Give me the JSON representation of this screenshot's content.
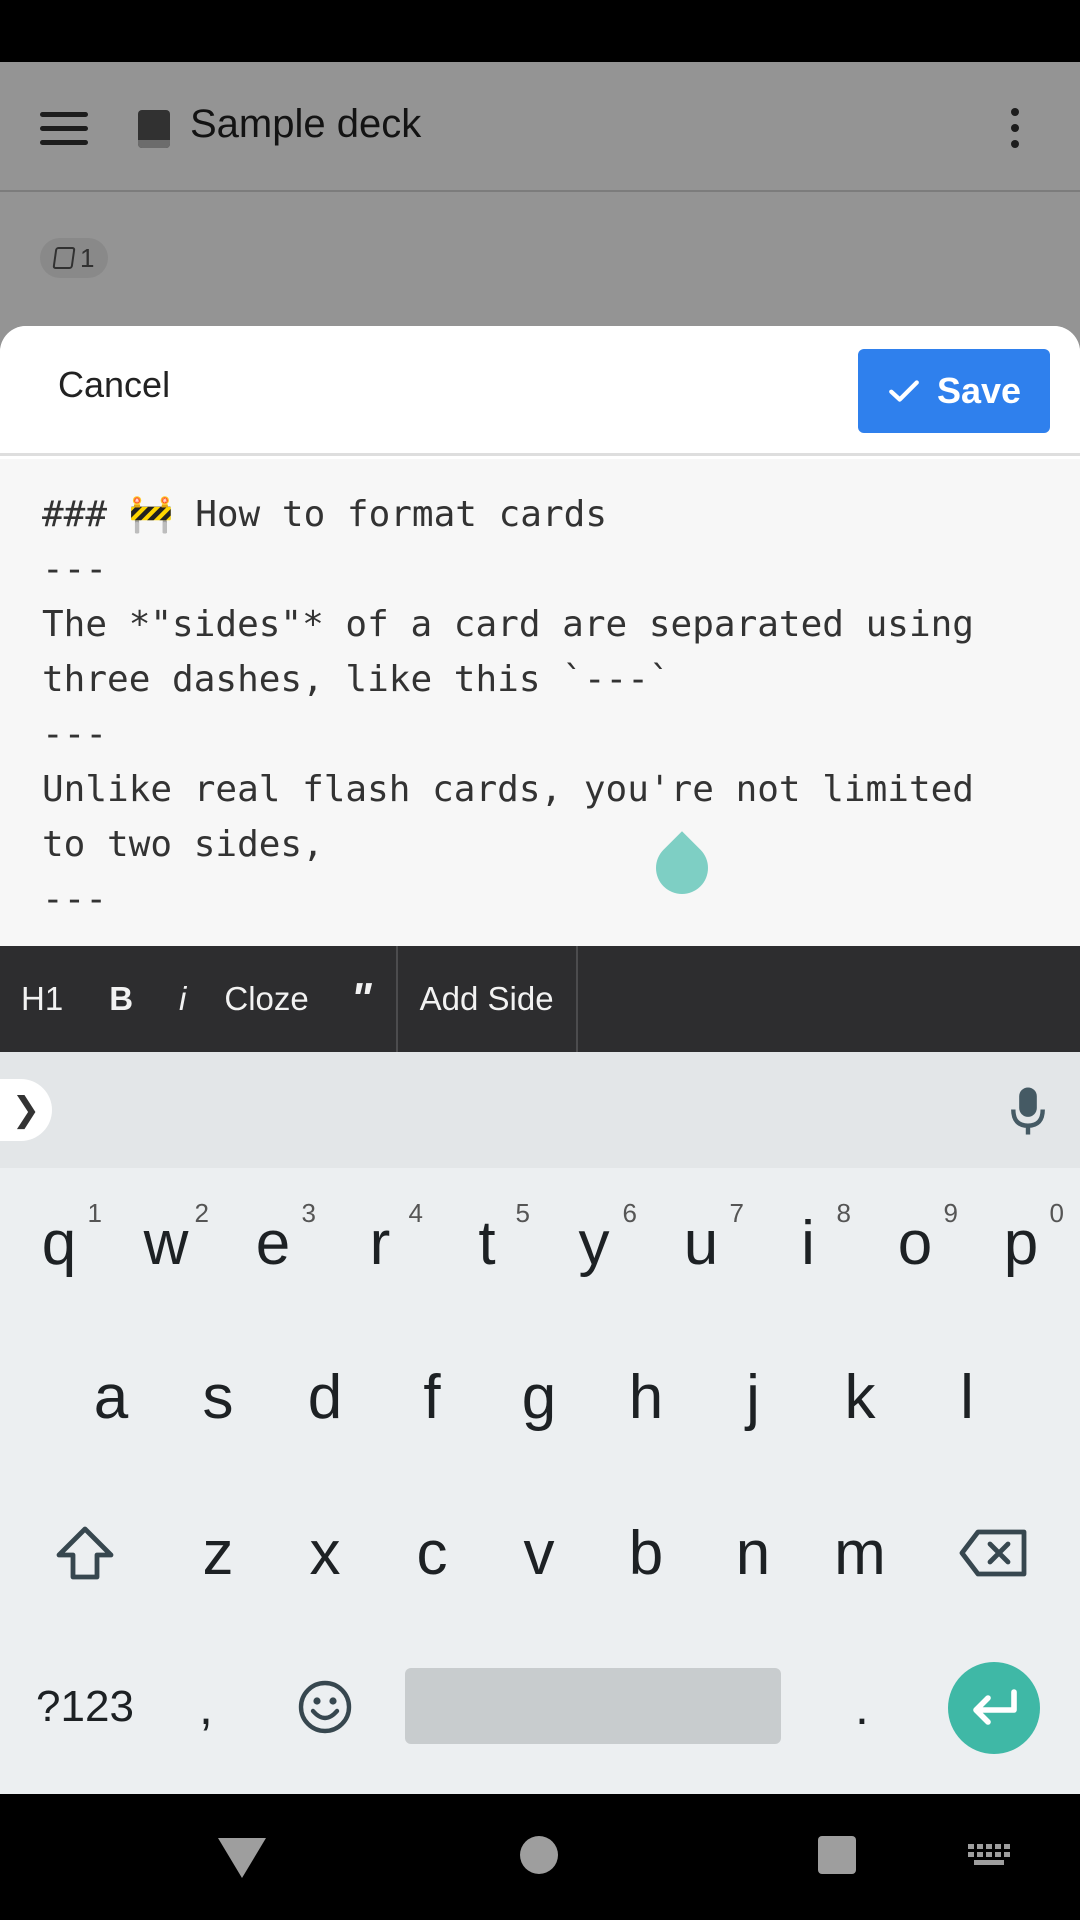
{
  "app": {
    "deck_title": "Sample deck",
    "card_count": "1"
  },
  "sheet": {
    "cancel_label": "Cancel",
    "save_label": "Save",
    "editor_lines": [
      "### 🚧 How to format cards",
      "---",
      "The *\"sides\"* of a card are separated using",
      "three dashes, like this `---`",
      "---",
      "Unlike real flash cards, you're not limited",
      "to two sides,",
      "---"
    ]
  },
  "format_toolbar": {
    "h1": "H1",
    "bold": "B",
    "italic": "i",
    "cloze": "Cloze",
    "quote": "\"",
    "add_side": "Add Side"
  },
  "keyboard": {
    "row1": [
      "q",
      "w",
      "e",
      "r",
      "t",
      "y",
      "u",
      "i",
      "o",
      "p"
    ],
    "row1_hints": [
      "1",
      "2",
      "3",
      "4",
      "5",
      "6",
      "7",
      "8",
      "9",
      "0"
    ],
    "row2": [
      "a",
      "s",
      "d",
      "f",
      "g",
      "h",
      "j",
      "k",
      "l"
    ],
    "row3": [
      "z",
      "x",
      "c",
      "v",
      "b",
      "n",
      "m"
    ],
    "symbols_label": "?123",
    "comma": ",",
    "period": "."
  }
}
